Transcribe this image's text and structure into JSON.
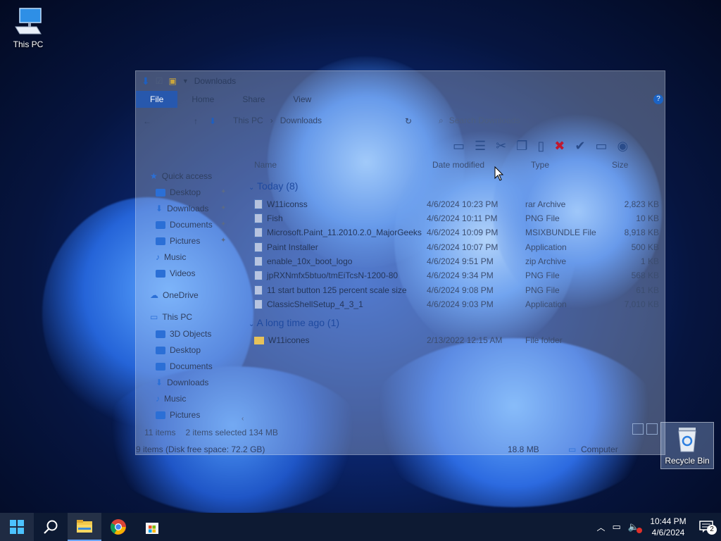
{
  "desktop": {
    "icons": [
      {
        "label": "This PC"
      },
      {
        "label": "Recycle Bin"
      }
    ]
  },
  "explorer": {
    "title": "Downloads",
    "ribbon_tabs": [
      "File",
      "Home",
      "Share",
      "View"
    ],
    "breadcrumb": [
      "This PC",
      "Downloads"
    ],
    "search_placeholder": "Search Downloads",
    "columns": {
      "name": "Name",
      "date": "Date modified",
      "type": "Type",
      "size": "Size"
    },
    "nav": {
      "quick_access": "Quick access",
      "quick_items": [
        "Desktop",
        "Downloads",
        "Documents",
        "Pictures",
        "Music",
        "Videos"
      ],
      "onedrive": "OneDrive",
      "this_pc": "This PC",
      "pc_items": [
        "3D Objects",
        "Desktop",
        "Documents",
        "Downloads",
        "Music",
        "Pictures"
      ]
    },
    "groups": [
      {
        "label": "Today (8)"
      },
      {
        "label": "A long time ago (1)"
      }
    ],
    "files_today": [
      {
        "name": "W11iconss",
        "date": "4/6/2024 10:23 PM",
        "type": "rar Archive",
        "size": "2,823 KB"
      },
      {
        "name": "Fish",
        "date": "4/6/2024 10:11 PM",
        "type": "PNG File",
        "size": "10 KB"
      },
      {
        "name": "Microsoft.Paint_11.2010.2.0_MajorGeeks",
        "date": "4/6/2024 10:09 PM",
        "type": "MSIXBUNDLE File",
        "size": "8,918 KB"
      },
      {
        "name": "Paint Installer",
        "date": "4/6/2024 10:07 PM",
        "type": "Application",
        "size": "500 KB"
      },
      {
        "name": "enable_10x_boot_logo",
        "date": "4/6/2024 9:51 PM",
        "type": "zip Archive",
        "size": "1 KB"
      },
      {
        "name": "jpRXNmfx5btuo/tmEiTcsN-1200-80",
        "date": "4/6/2024 9:34 PM",
        "type": "PNG File",
        "size": "568 KB"
      },
      {
        "name": "11 start button 125 percent scale size",
        "date": "4/6/2024 9:08 PM",
        "type": "PNG File",
        "size": "61 KB"
      },
      {
        "name": "ClassicShellSetup_4_3_1",
        "date": "4/6/2024 9:03 PM",
        "type": "Application",
        "size": "7,010 KB"
      }
    ],
    "files_old": [
      {
        "name": "W11icones",
        "date": "2/13/2022 12:15 AM",
        "type": "File folder",
        "size": ""
      }
    ],
    "status": {
      "items": "11 items",
      "selected": "2 items selected  134 MB",
      "bottom_left": "9 items (Disk free space: 72.2 GB)",
      "bottom_size": "18.8 MB",
      "bottom_location": "Computer"
    }
  },
  "taskbar": {
    "time": "10:44 PM",
    "date": "4/6/2024",
    "notification_count": "2"
  }
}
